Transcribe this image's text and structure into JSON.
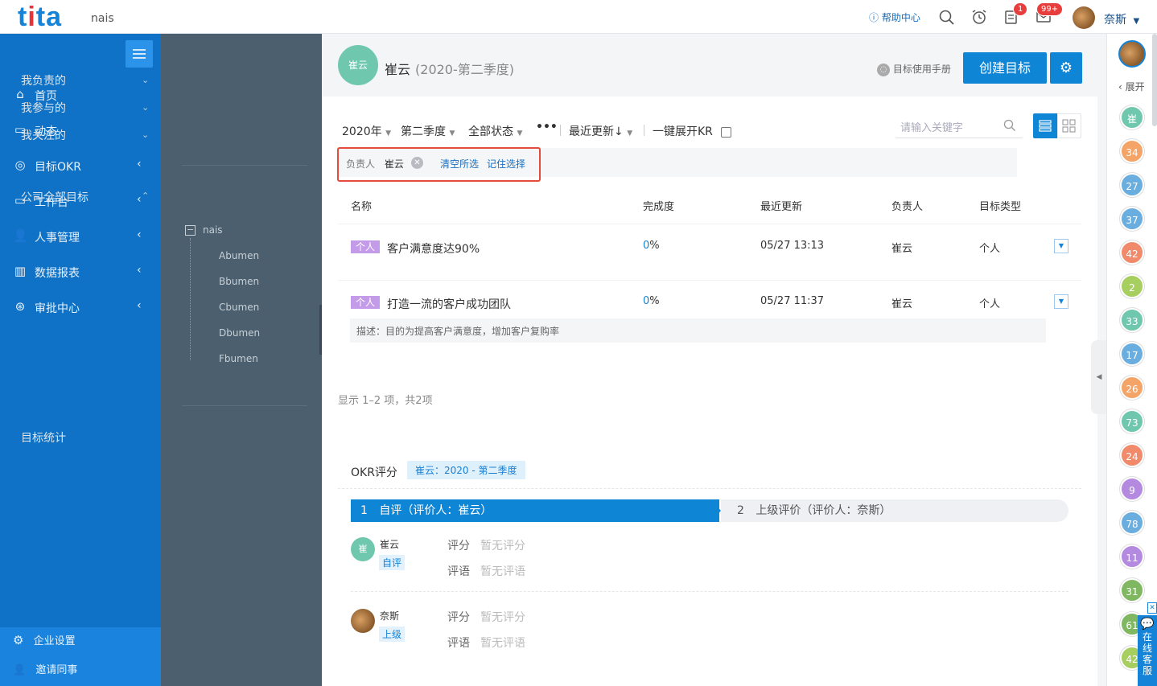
{
  "topbar": {
    "logo": "tita",
    "company": "nais",
    "help": "帮助中心",
    "badge_tasks": "1",
    "badge_mail": "99+",
    "user_name": "奈斯"
  },
  "nav": {
    "items": [
      {
        "label": "首页",
        "icon": "home-icon"
      },
      {
        "label": "动态",
        "icon": "chat-icon"
      },
      {
        "label": "目标OKR",
        "icon": "target-icon"
      },
      {
        "label": "工作台",
        "icon": "monitor-icon"
      },
      {
        "label": "人事管理",
        "icon": "people-icon"
      },
      {
        "label": "数据报表",
        "icon": "chart-icon"
      },
      {
        "label": "审批中心",
        "icon": "approval-icon"
      }
    ],
    "settings": "企业设置",
    "invite": "邀请同事"
  },
  "subnav": {
    "mine": "我负责的",
    "participated": "我参与的",
    "followed": "我关注的",
    "company_all": "公司全部目标",
    "root": "nais",
    "depts": [
      "Abumen",
      "Bbumen",
      "Cbumen",
      "Dbumen",
      "Fbumen"
    ],
    "stats": "目标统计"
  },
  "header": {
    "avatar_text": "崔云",
    "name": "崔云",
    "season": "(2020-第二季度)",
    "manual": "目标使用手册",
    "create_button": "创建目标"
  },
  "filters": {
    "year": "2020年",
    "quarter": "第二季度",
    "status": "全部状态",
    "more": "•••",
    "sort": "最近更新↓",
    "expand_kr": "一键展开KR",
    "search_placeholder": "请输入关键字",
    "chip_label": "负责人",
    "chip_value": "崔云",
    "clear": "清空所选",
    "remember": "记住选择"
  },
  "table": {
    "headers": [
      "名称",
      "完成度",
      "最近更新",
      "负责人",
      "目标类型"
    ],
    "rows": [
      {
        "tag": "个人",
        "name": "客户满意度达90%",
        "progress_num": "0",
        "progress_unit": "%",
        "updated": "05/27 13:13",
        "owner": "崔云",
        "type": "个人"
      },
      {
        "tag": "个人",
        "name": "打造一流的客户成功团队",
        "progress_num": "0",
        "progress_unit": "%",
        "updated": "05/27 11:37",
        "owner": "崔云",
        "type": "个人",
        "desc": "描述：目的为提高客户满意度，增加客户复购率"
      }
    ],
    "summary": "显示 1–2 项，共2项"
  },
  "okr": {
    "title": "OKR评分",
    "tag": "崔云：2020 - 第二季度",
    "step1_num": "1",
    "step1": "自评（评价人：崔云）",
    "step2_num": "2",
    "step2": "上级评价（评价人：奈斯）",
    "reviewers": [
      {
        "avatar": "崔",
        "name": "崔云",
        "role": "自评",
        "score_label": "评分",
        "score": "暂无评分",
        "comment_label": "评语",
        "comment": "暂无评语"
      },
      {
        "avatar": "",
        "name": "奈斯",
        "role": "上级",
        "score_label": "评分",
        "score": "暂无评分",
        "comment_label": "评语",
        "comment": "暂无评语"
      }
    ]
  },
  "rightbar": {
    "expand": "展开",
    "avatars": [
      {
        "text": "崔",
        "color": "#6fc8ae"
      },
      {
        "text": "34",
        "color": "#f4a466"
      },
      {
        "text": "27",
        "color": "#6aaee0"
      },
      {
        "text": "37",
        "color": "#6aaee0"
      },
      {
        "text": "42",
        "color": "#f08a6b"
      },
      {
        "text": "2",
        "color": "#a6cf5f"
      },
      {
        "text": "33",
        "color": "#6fc8ae"
      },
      {
        "text": "17",
        "color": "#6aaee0"
      },
      {
        "text": "26",
        "color": "#f4a466"
      },
      {
        "text": "73",
        "color": "#6fc8ae"
      },
      {
        "text": "24",
        "color": "#f08a6b"
      },
      {
        "text": "9",
        "color": "#b48ae0"
      },
      {
        "text": "78",
        "color": "#6aaee0"
      },
      {
        "text": "11",
        "color": "#b48ae0"
      },
      {
        "text": "31",
        "color": "#7fb860"
      },
      {
        "text": "61",
        "color": "#7fb860"
      },
      {
        "text": "42",
        "color": "#a6cf5f"
      }
    ],
    "service": "在线客服"
  }
}
